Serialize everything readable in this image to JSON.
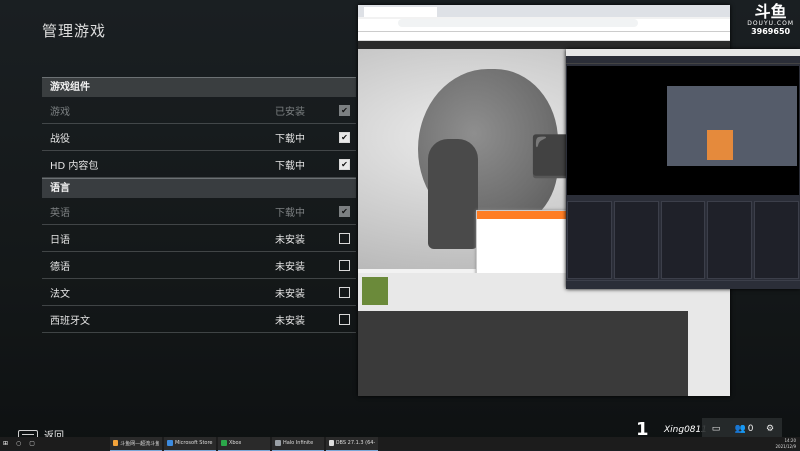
{
  "page": {
    "title": "管理游戏"
  },
  "sections": [
    {
      "header": "游戏组件",
      "rows": [
        {
          "name": "游戏",
          "status": "已安装",
          "checked": true,
          "disabled": true
        },
        {
          "name": "战役",
          "status": "下载中",
          "checked": true,
          "disabled": false
        },
        {
          "name": "HD 内容包",
          "status": "下载中",
          "checked": true,
          "disabled": false
        }
      ]
    },
    {
      "header": "语言",
      "rows": [
        {
          "name": "英语",
          "status": "下载中",
          "checked": true,
          "disabled": true
        },
        {
          "name": "日语",
          "status": "未安装",
          "checked": false,
          "disabled": false
        },
        {
          "name": "德语",
          "status": "未安装",
          "checked": false,
          "disabled": false
        },
        {
          "name": "法文",
          "status": "未安装",
          "checked": false,
          "disabled": false
        },
        {
          "name": "西班牙文",
          "status": "未安装",
          "checked": false,
          "disabled": false
        }
      ]
    }
  ],
  "back": {
    "label": "返回"
  },
  "watermark": {
    "logo": "斗鱼",
    "site": "DOUYU.COM",
    "room": "3969650"
  },
  "player": {
    "number": "1",
    "gamertag": "Xing0811",
    "party_count": "0"
  },
  "taskbar": {
    "items": [
      {
        "label": "斗鱼网—超流斗鱼...",
        "icon_color": "#f2a33a"
      },
      {
        "label": "Microsoft Store",
        "icon_color": "#3c8be0"
      },
      {
        "label": "Xbox",
        "icon_color": "#2ba84a"
      },
      {
        "label": "Halo Infinite",
        "icon_color": "#9aa0a6"
      },
      {
        "label": "OBS 27.1.3 (64-bit...",
        "icon_color": "#dddddd"
      }
    ],
    "time": "14:20",
    "date": "2021/12/9"
  },
  "colors": {
    "accent": "#ff7d24",
    "panel_header": "#464a4c"
  }
}
